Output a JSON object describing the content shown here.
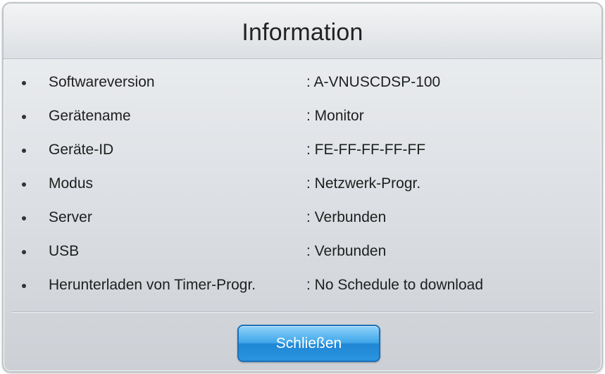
{
  "dialog": {
    "title": "Information",
    "rows": [
      {
        "label": "Softwareversion",
        "value": ": A-VNUSCDSP-100"
      },
      {
        "label": "Gerätename",
        "value": ": Monitor"
      },
      {
        "label": "Geräte-ID",
        "value": ": FE-FF-FF-FF-FF"
      },
      {
        "label": "Modus",
        "value": ": Netzwerk-Progr."
      },
      {
        "label": "Server",
        "value": ": Verbunden"
      },
      {
        "label": "USB",
        "value": ": Verbunden"
      },
      {
        "label": "Herunterladen von Timer-Progr.",
        "value": ": No Schedule to download"
      }
    ],
    "close_label": "Schließen"
  },
  "colors": {
    "button_accent": "#3fa6e8",
    "background": "#dfe2e6"
  }
}
